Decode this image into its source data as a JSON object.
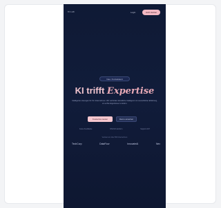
{
  "nav": {
    "brand": "KI-Lab",
    "login": "Login",
    "cta": "Jetzt starten"
  },
  "hero": {
    "badge": "Neu: KI-Assistent",
    "headline_main": "KI trifft",
    "headline_accent": "Expertise",
    "lead": "Intelligente Lösungen für Ihr Unternehmen. Wir verbinden künstliche Intelligenz mit menschlicher Erfahrung, um echte Ergebnisse zu liefern.",
    "primary_cta": "Kostenlos testen",
    "secondary_cta": "Demo ansehen"
  },
  "trust": {
    "items": [
      "Keine Kreditkarte",
      "DSGVO-konform",
      "Support 24/7"
    ],
    "label": "Vertraut von über 500 Unternehmen"
  },
  "logos": [
    "TechCorp",
    "DataFlow",
    "InnovateAI",
    "Nex"
  ]
}
